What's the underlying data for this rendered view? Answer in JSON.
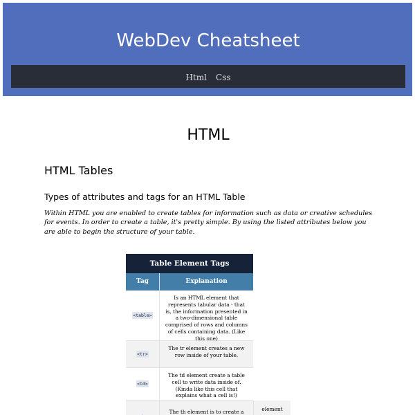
{
  "header": {
    "title": "WebDev Cheatsheet",
    "colors": {
      "header_bg": "#506ebc",
      "nav_bg": "#282d38"
    }
  },
  "nav": {
    "items": [
      {
        "label": "Html"
      },
      {
        "label": "Css"
      }
    ]
  },
  "main": {
    "heading": "HTML",
    "section_heading": "HTML Tables",
    "sub_heading": "Types of attributes and tags for an HTML Table",
    "intro": "Within HTML you are enabled to create tables for information such as data or creative schedules for events. In order to create a table, it's pretty simple. By using the listed attributes below you are able to begin the structure of your table."
  },
  "table": {
    "caption": "Table Element Tags",
    "columns": [
      "Tag",
      "Explanation"
    ],
    "rows": [
      {
        "tag": "<table>",
        "explanation": "Is an HTML element that represents tabular data - that is, the information presented in a two-dimensional table comprised of rows and columns of cells containing data. (Like this one)"
      },
      {
        "tag": "<tr>",
        "explanation": "The tr element creates a new row inside of your table."
      },
      {
        "tag": "<td>",
        "explanation": "The td element create a table cell to write data inside of. (Kinda like this cell that explains what a cell is!)"
      },
      {
        "tag": "",
        "explanation": "The th element is to create a",
        "extra": "element"
      }
    ],
    "colors": {
      "caption_bg": "#162238",
      "head_bg": "#427ea8"
    }
  }
}
